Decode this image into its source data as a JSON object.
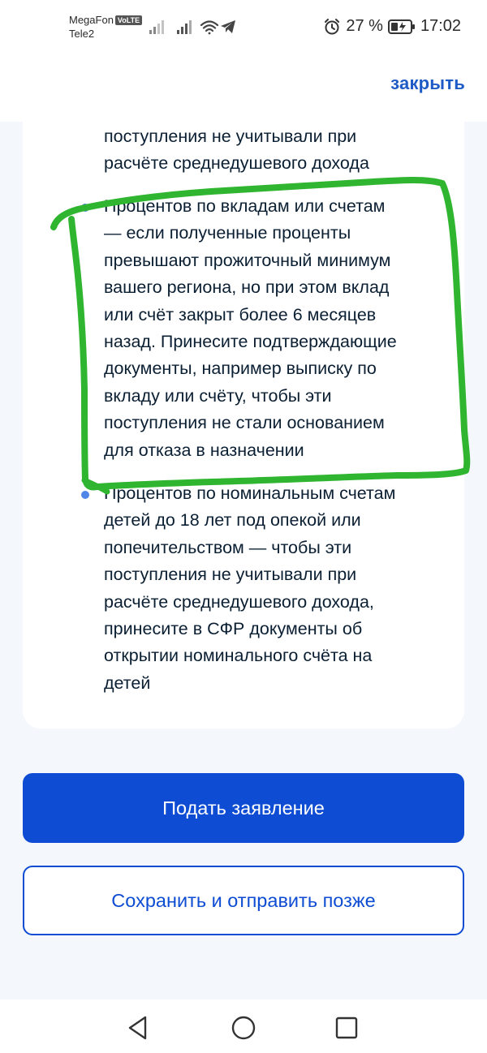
{
  "status_bar": {
    "carrier_1": "MegaFon",
    "volte_badge": "VoLTE",
    "carrier_2": "Tele2",
    "battery": "27 %",
    "time": "17:02"
  },
  "header": {
    "close_label": "закрыть"
  },
  "content": {
    "top_partial_lines": [
      "поступления не учитывали при",
      "расчёте среднедушевого дохода"
    ],
    "items": [
      {
        "lines": [
          "Процентов по вкладам или счетам",
          "— если полученные проценты",
          "превышают прожиточный минимум",
          "вашего региона, но при этом вклад",
          "или счёт закрыт более 6 месяцев",
          "назад. Принесите подтверждающие",
          "документы, например выписку по",
          "вкладу или счёту, чтобы эти",
          "поступления не стали основанием",
          "для отказа в назначении"
        ]
      },
      {
        "lines": [
          "Процентов по номинальным счетам",
          "детей до 18 лет под опекой или",
          "попечительством — чтобы эти",
          "поступления не учитывали при",
          "расчёте среднедушевого дохода,",
          "принесите в СФР документы об",
          "открытии номинального счёта на",
          "детей"
        ]
      }
    ]
  },
  "actions": {
    "submit_label": "Подать заявление",
    "save_later_label": "Сохранить и отправить позже"
  },
  "colors": {
    "accent": "#0d4cd3",
    "link": "#1e5bc6",
    "bullet": "#4f86e8",
    "annotation": "#2fb52f"
  }
}
